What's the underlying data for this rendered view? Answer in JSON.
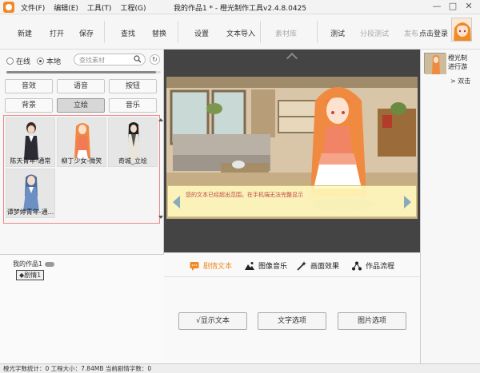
{
  "window": {
    "title": "我的作品1 * - 橙光制作工具v2.4.8.0425",
    "menu": [
      "文件(F)",
      "编辑(E)",
      "工具(T)",
      "工程(G)"
    ],
    "controls": [
      "—",
      "□",
      "✕"
    ]
  },
  "toolbar": {
    "new": "新建",
    "open": "打开",
    "save": "保存",
    "find": "查找",
    "replace": "替换",
    "settings": "设置",
    "text_import": "文本导入",
    "material_lib": "素材库",
    "test": "测试",
    "branch_test": "分段测试",
    "publish": "发布",
    "login": "点击登录"
  },
  "left": {
    "radio_online": "在线",
    "radio_local": "本地",
    "search_placeholder": "查找素材",
    "slider_level": 0.97,
    "categories": [
      "音效",
      "语音",
      "按钮",
      "背景",
      "立绘",
      "音乐"
    ],
    "active_category": "立绘",
    "thumbs": [
      "陈天青年-通常",
      "柳丁少女-微笑",
      "奇城_立绘",
      "谭梦婷青年-通..."
    ],
    "tree_root": "我的作品1",
    "tree_node": "◆剧情1"
  },
  "canvas": {
    "dialog_text": "您的文本已经超出范围，在手机端无法完整显示"
  },
  "bottom": {
    "tabs": [
      "剧情文本",
      "图像音乐",
      "画面效果",
      "作品流程"
    ],
    "active_tab": "剧情文本",
    "btn_show_text": "√显示文本",
    "btn_text_option": "文字选项",
    "btn_image_option": "图片选项"
  },
  "right": {
    "item_title_1": "橙光制",
    "item_title_2": "进行游",
    "item_sub": "> 双击"
  },
  "status": {
    "text": "橙光字数统计：0  工程大小：7.84MB  当前剧情字数：0"
  },
  "colors": {
    "accent": "#f08a24",
    "dialog_bg": "#fffabe",
    "dialog_text": "#c34747",
    "gallery_border": "#ee8888"
  }
}
